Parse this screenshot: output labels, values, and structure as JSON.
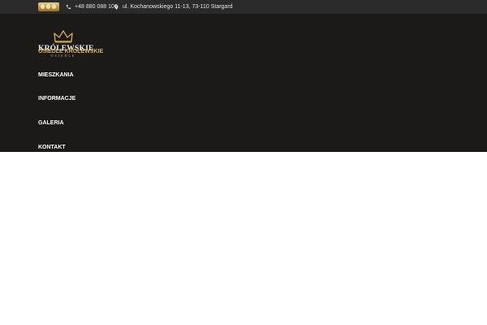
{
  "topbar": {
    "phone": "+48 880 088 100",
    "address": "ul. Kochanowskiego 11-13, 73-110 Stargard"
  },
  "brand": {
    "name": "KRÓLEWSKIE",
    "subtitle": "OSIEDLE"
  },
  "nav": {
    "items": [
      {
        "label": "OSIEDLE KRÓLEWSKIE",
        "active": true
      },
      {
        "label": "MIESZKANIA",
        "active": false
      },
      {
        "label": "INFORMACJE",
        "active": false
      },
      {
        "label": "GALERIA",
        "active": false
      },
      {
        "label": "KONTAKT",
        "active": false
      }
    ]
  },
  "colors": {
    "topbar_bg": "#2a2a2a",
    "header_bg": "#1b1a19",
    "accent_gold": "#d2b55b"
  }
}
